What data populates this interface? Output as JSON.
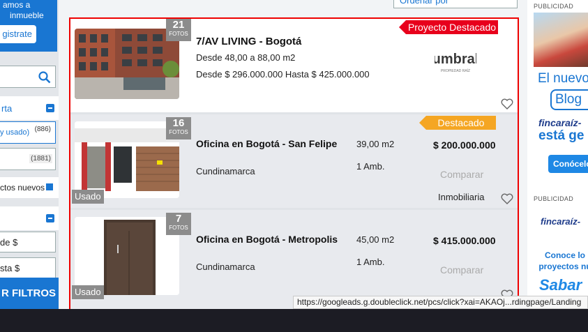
{
  "sidebar": {
    "promo_line1": "amos a",
    "promo_line2": "inmueble",
    "register_button": "gistrate",
    "section1_title": "rta",
    "filter_used": "y usado)",
    "filter_used_count": "(886)",
    "filter_other_count": "(1881)",
    "new_projects": "ctos nuevos",
    "price_from": "de $",
    "price_to": "sta $",
    "apply_filters": "R FILTROS"
  },
  "sort": {
    "value": "Ordenar por"
  },
  "listings": [
    {
      "photos_count": "21",
      "photos_label": "FOTOS",
      "title": "7/AV LIVING - Bogotá",
      "area": "Desde 48,00 a 88,00 m2",
      "price_range": "Desde $ 296.000.000 Hasta $ 425.000.000",
      "ribbon": "Proyecto Destacado",
      "logo_text": "umbral",
      "logo_sub": "PROPIEDAD RAÍZ"
    },
    {
      "photos_count": "16",
      "photos_label": "FOTOS",
      "used_tag": "Usado",
      "title": "Oficina en Bogotá - San Felipe",
      "area": "39,00 m2",
      "price": "$ 200.000.000",
      "location": "Cundinamarca",
      "rooms": "1 Amb.",
      "compare": "Comparar",
      "agency": "Inmobiliaria",
      "ribbon": "Destacado"
    },
    {
      "photos_count": "7",
      "photos_label": "FOTOS",
      "used_tag": "Usado",
      "title": "Oficina en Bogotá - Metropolis",
      "area": "45,00 m2",
      "price": "$ 415.000.000",
      "location": "Cundinamarca",
      "rooms": "1 Amb.",
      "compare": "Comparar"
    }
  ],
  "ads": {
    "label": "PUBLICIDAD",
    "ad1_line1": "El nuevo",
    "ad1_blog": "Blog",
    "ad1_brand": "fincaraíz-",
    "ad1_tagline": "está ge",
    "ad1_button": "Conócelo",
    "ad2_brand": "fincaraíz-",
    "ad2_text": "Conoce lo proyectos nu",
    "ad2_logo": "Sabar"
  },
  "status_url": "https://googleads.g.doubleclick.net/pcs/click?xai=AKAOj...rdingpage/Landing"
}
